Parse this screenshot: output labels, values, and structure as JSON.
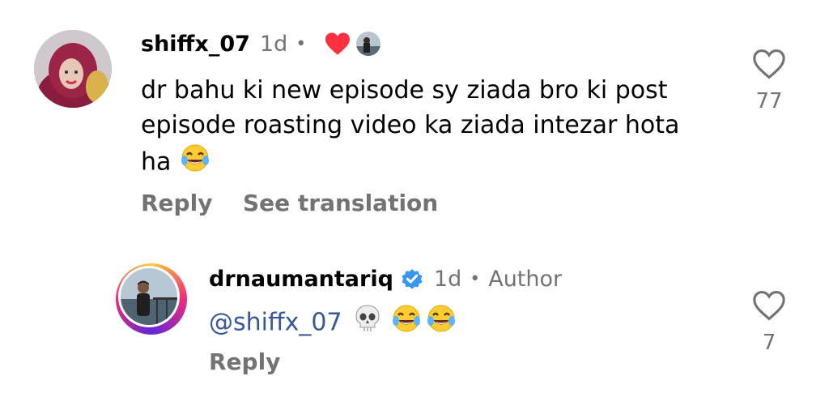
{
  "comments": [
    {
      "username": "shiffx_07",
      "time": "1d",
      "body": "dr bahu ki new episode sy ziada bro ki post episode roasting video ka ziada intezar hota ha",
      "reply_label": "Reply",
      "translate_label": "See translation",
      "like_count": "77"
    }
  ],
  "reply": {
    "username": "drnaumantariq",
    "time": "1d",
    "author_label": "Author",
    "mention": "@shiffx_07",
    "reply_label": "Reply",
    "like_count": "7"
  },
  "colors": {
    "muted": "#737373",
    "mention": "#385898",
    "heart": "#ff3040",
    "verified": "#3897f0"
  }
}
